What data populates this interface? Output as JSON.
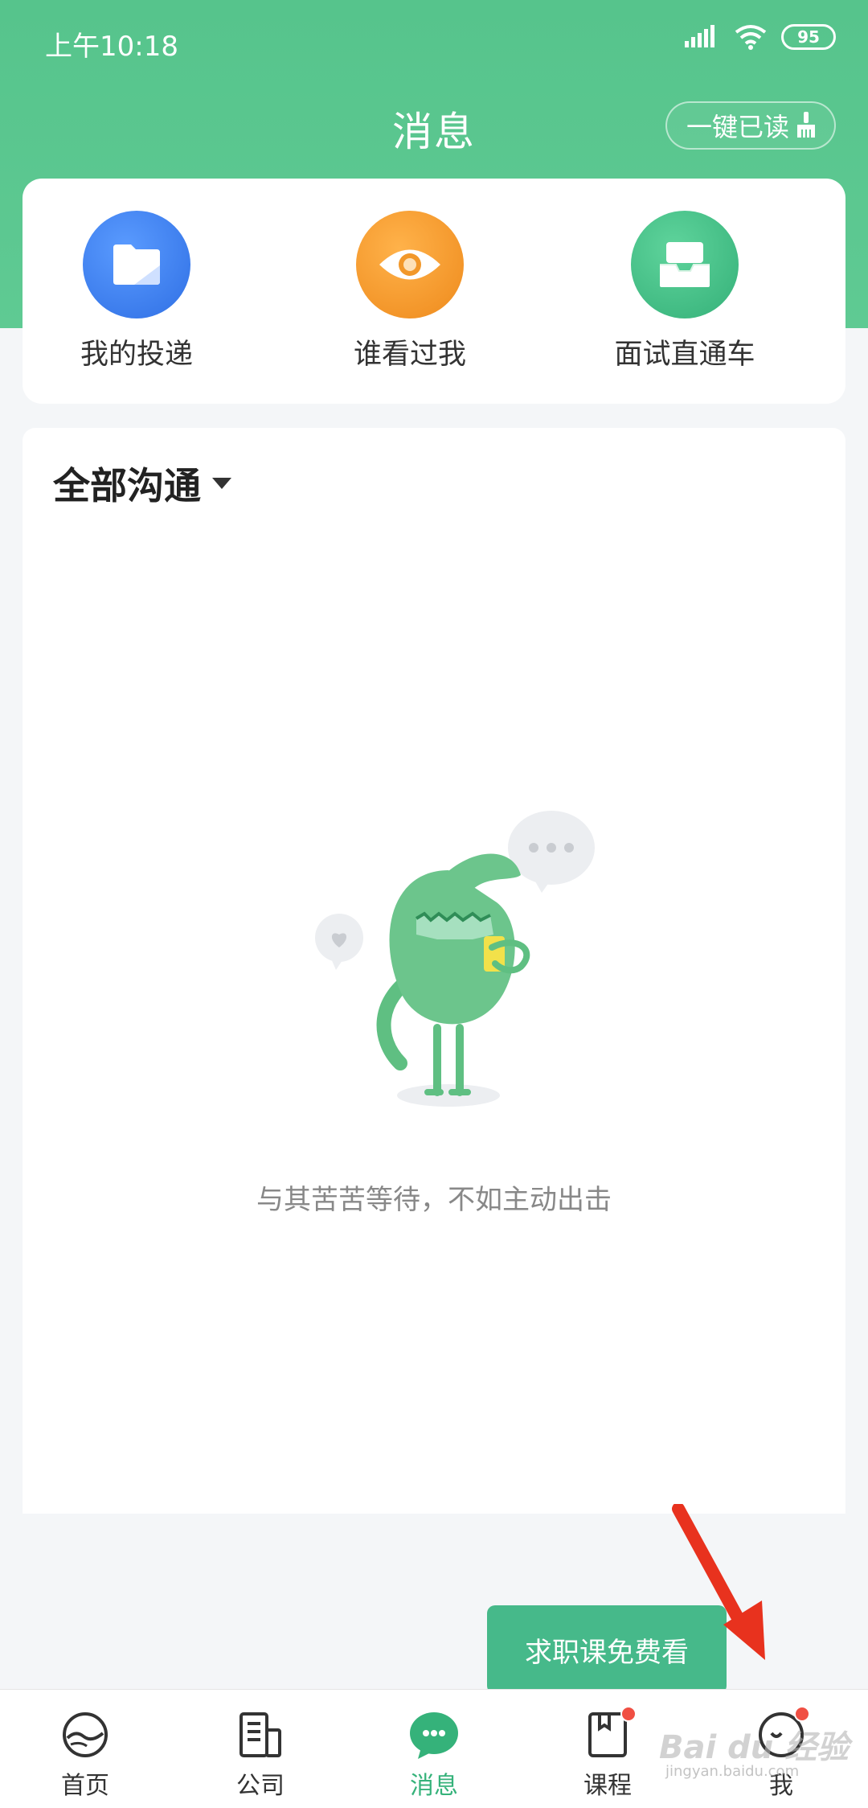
{
  "status_bar": {
    "time": "上午10:18",
    "battery": "95"
  },
  "header": {
    "title": "消息",
    "read_all_label": "一键已读"
  },
  "quick_actions": [
    {
      "label": "我的投递",
      "icon": "folder-icon",
      "color": "#3b7ff0"
    },
    {
      "label": "谁看过我",
      "icon": "eye-icon",
      "color": "#f2982a"
    },
    {
      "label": "面试直通车",
      "icon": "inbox-tray-icon",
      "color": "#3fbd85"
    }
  ],
  "chat": {
    "filter_label": "全部沟通",
    "empty_text": "与其苦苦等待，不如主动出击"
  },
  "promo": {
    "label": "求职课免费看"
  },
  "tab_bar": {
    "items": [
      {
        "label": "首页",
        "icon": "home-wave-icon",
        "active": false,
        "badge": false
      },
      {
        "label": "公司",
        "icon": "building-icon",
        "active": false,
        "badge": false
      },
      {
        "label": "消息",
        "icon": "chat-bubble-icon",
        "active": true,
        "badge": false
      },
      {
        "label": "课程",
        "icon": "book-icon",
        "active": false,
        "badge": true
      },
      {
        "label": "我",
        "icon": "smiley-face-icon",
        "active": false,
        "badge": true
      }
    ]
  },
  "colors": {
    "header_green": "#56c48c",
    "active_tab": "#35b27a",
    "badge_red": "#f04f43",
    "annotation_arrow": "#e8321e"
  },
  "watermark": {
    "brand": "Bai du 经验",
    "url": "jingyan.baidu.com"
  }
}
